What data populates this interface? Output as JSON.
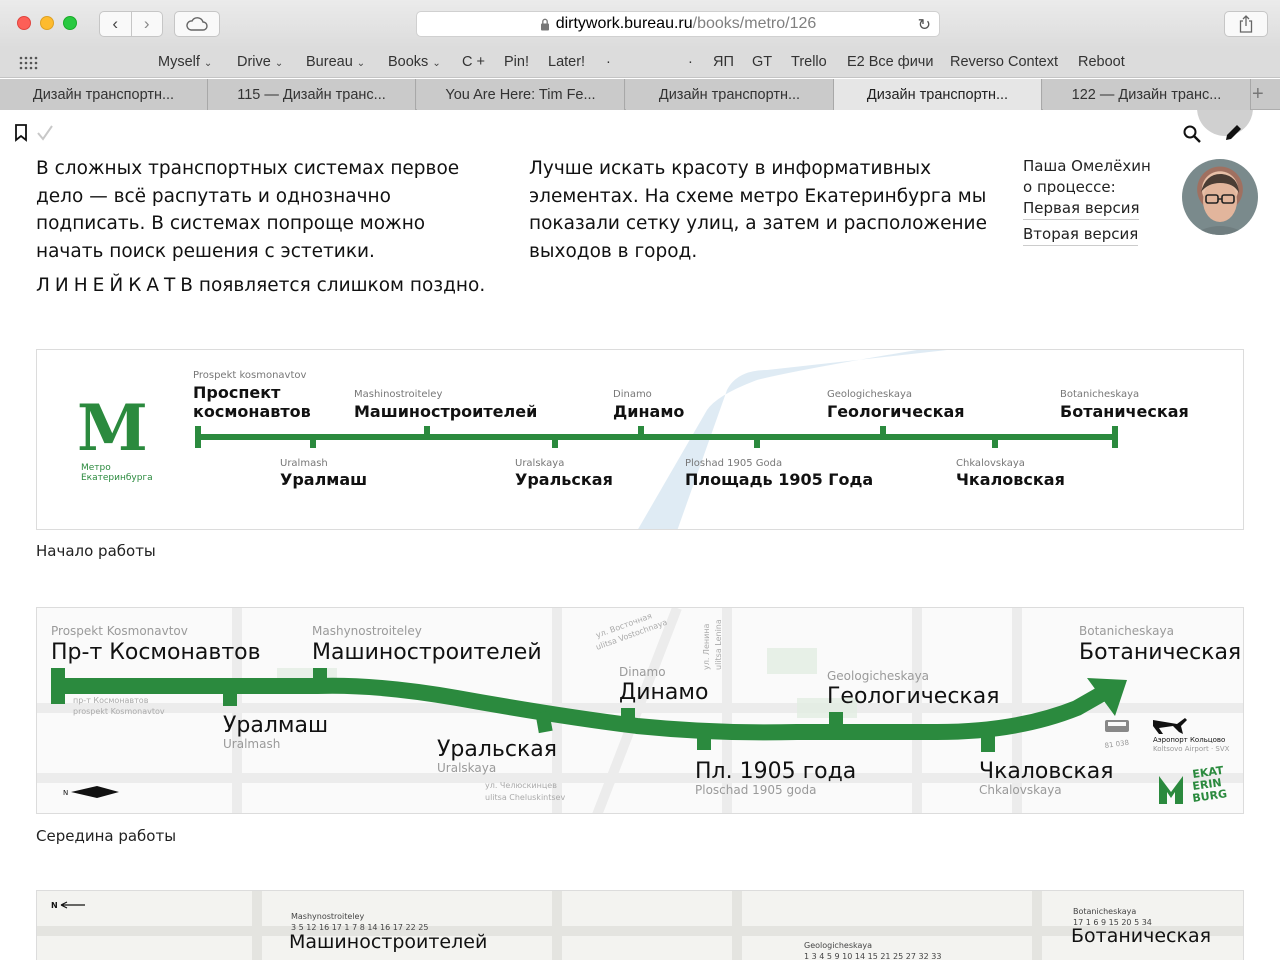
{
  "browser": {
    "url_host": "dirtywork.bureau.ru",
    "url_path": "/books/metro/126",
    "bookmarks": [
      "Myself",
      "Drive",
      "Bureau",
      "Books",
      "C +",
      "Pin!",
      "Later!",
      "·",
      "·",
      "ЯП",
      "GT",
      "Trello",
      "E2 Все фичи",
      "Reverso Context",
      "Reboot"
    ],
    "tabs": [
      {
        "label": "Дизайн транспортн...",
        "active": false
      },
      {
        "label": "115 — Дизайн транс...",
        "active": false
      },
      {
        "label": "You Are Here: Tim Fe...",
        "active": false
      },
      {
        "label": "Дизайн транспортн...",
        "active": false
      },
      {
        "label": "Дизайн транспортн...",
        "active": true
      },
      {
        "label": "122 — Дизайн транс...",
        "active": false
      }
    ],
    "new_tab_label": "+"
  },
  "article": {
    "left_paragraph": "В сложных транспортных системах первое дело — всё распутать и однозначно подписать. В системах попроще можно начать поиск решения с эстетики.",
    "right_paragraph": "Лучше искать красоту в информативных элементах. На схеме метро Екатеринбурга мы показали сетку улиц, а затем и расположение выходов в город.",
    "kerned_word": "ЛИНЕЙКАТ",
    "kerned_tail": "В",
    "line2_tail": " появляется слишком поздно.",
    "author_name": "Паша Омелёхин",
    "author_about": "о процессе:",
    "link_first": "Первая версия",
    "link_second": "Вторая версия",
    "caption_1": "Начало работы",
    "caption_2": "Середина работы"
  },
  "map1": {
    "logo_letter": "M",
    "logo_line1": "Метро",
    "logo_line2": "Екатеринбурга",
    "line_color": "#2b8a3e",
    "stations": [
      {
        "latin": "Prospekt kosmonavtov",
        "name1": "Проспект",
        "name2": "космонавтов",
        "side": "top"
      },
      {
        "latin": "Uralmash",
        "name1": "Уралмаш",
        "name2": "",
        "side": "bottom"
      },
      {
        "latin": "Mashinostroiteley",
        "name1": "Машиностроителей",
        "name2": "",
        "side": "top"
      },
      {
        "latin": "Uralskaya",
        "name1": "Уральская",
        "name2": "",
        "side": "bottom"
      },
      {
        "latin": "Dinamo",
        "name1": "Динамо",
        "name2": "",
        "side": "top"
      },
      {
        "latin": "Ploshad 1905 Goda",
        "name1": "Площадь 1905 Года",
        "name2": "",
        "side": "bottom"
      },
      {
        "latin": "Geologicheskaya",
        "name1": "Геологическая",
        "name2": "",
        "side": "top"
      },
      {
        "latin": "Chkalovskaya",
        "name1": "Чкаловская",
        "name2": "",
        "side": "bottom"
      },
      {
        "latin": "Botanicheskaya",
        "name1": "Ботаническая",
        "name2": "",
        "side": "top"
      }
    ]
  },
  "map2": {
    "line_color": "#2b8a3e",
    "stations": [
      {
        "latin": "Prospekt Kosmonavtov",
        "name": "Пр-т Космонавтов"
      },
      {
        "latin": "Uralmash",
        "name": "Уралмаш"
      },
      {
        "latin": "Mashynostroiteley",
        "name": "Машиностроителей"
      },
      {
        "latin": "Uralskaya",
        "name": "Уральская"
      },
      {
        "latin": "Dinamo",
        "name": "Динамо"
      },
      {
        "latin": "Ploschad 1905 goda",
        "name": "Пл. 1905 года"
      },
      {
        "latin": "Geologicheskaya",
        "name": "Геологическая"
      },
      {
        "latin": "Chkalovskaya",
        "name": "Чкаловская"
      },
      {
        "latin": "Botanicheskaya",
        "name": "Ботаническая"
      }
    ],
    "streets": [
      "пр-т Космонавтов",
      "prospekt Kosmonavtov",
      "ул. Восточная",
      "ulitsa Vostochnaya",
      "ул. Челюскинцев",
      "ulitsa Cheluskintsev",
      "ул. Ленина",
      "ulitsa Lenina"
    ],
    "airport_line1": "Аэропорт Кольцово",
    "airport_line2": "Koltsovo Airport · SVX",
    "bus_number": "81 038",
    "brand_text": [
      "EKAT",
      "ERIN",
      "BURG"
    ]
  },
  "map3": {
    "compass": "N",
    "stations": [
      {
        "latin": "Mashynostroiteley",
        "name": "Машиностроителей",
        "routes": "3 5 12 16 17  1 7 8 14 16 17 22 25"
      },
      {
        "latin": "Geologicheskaya",
        "name": "",
        "routes": "1 3 4 5 9 10 14 15 21 25 27 32 33"
      },
      {
        "latin": "Botanicheskaya",
        "name": "Ботаническая",
        "routes": "17  1 6 9 15 20  5 34"
      }
    ]
  }
}
